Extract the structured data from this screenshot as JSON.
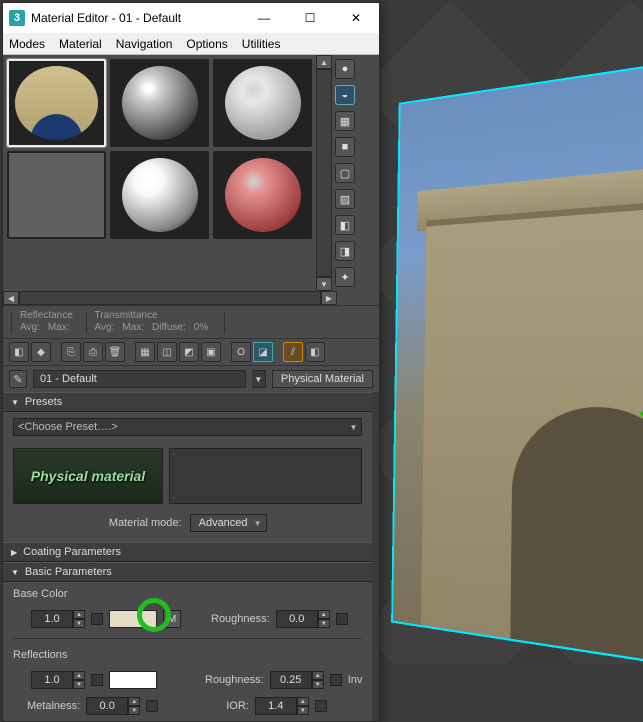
{
  "window": {
    "title": "Material Editor - 01 - Default",
    "minimize_glyph": "—",
    "maximize_glyph": "☐",
    "close_glyph": "✕",
    "app_icon_text": "3"
  },
  "menu": {
    "items": [
      "Modes",
      "Material",
      "Navigation",
      "Options",
      "Utilities"
    ]
  },
  "info": {
    "reflectance_label": "Reflectance",
    "transmittance_label": "Transmittance",
    "avg_label": "Avg:",
    "max_label": "Max:",
    "diffuse_label": "Diffuse:",
    "diffuse_value": "0%"
  },
  "material": {
    "name": "01 - Default",
    "type_label": "Physical Material"
  },
  "presets": {
    "header": "Presets",
    "choose_label": "<Choose Preset….>",
    "logo_text": "Physical material",
    "mode_label": "Material mode:",
    "mode_value": "Advanced"
  },
  "coating": {
    "header": "Coating Parameters"
  },
  "basic": {
    "header": "Basic Parameters",
    "base_color_label": "Base Color",
    "base_weight": "1.0",
    "base_color_hex": "#e6dcc6",
    "map_btn": "M",
    "roughness_label": "Roughness:",
    "base_roughness": "0.0",
    "reflections_label": "Reflections",
    "refl_weight": "1.0",
    "refl_color_hex": "#ffffff",
    "refl_roughness_label": "Roughness:",
    "refl_roughness": "0.25",
    "inv_label": "Inv",
    "metalness_label": "Metalness:",
    "metalness_value": "0.0",
    "ior_label": "IOR:",
    "ior_value": "1.4"
  },
  "chevrons": {
    "down": "▼",
    "right": "▶",
    "left": "◀",
    "updn": "⇕"
  },
  "side_icons": [
    "●",
    "◒",
    "▦",
    "■",
    "▢",
    "▨",
    "◧",
    "◨",
    "✦"
  ],
  "tool_icons": [
    "◧",
    "◆",
    "⎘",
    "⎙",
    "🗑",
    "▦",
    "◫",
    "◩",
    "▣",
    "O",
    "◪",
    "⫽",
    "◧"
  ]
}
